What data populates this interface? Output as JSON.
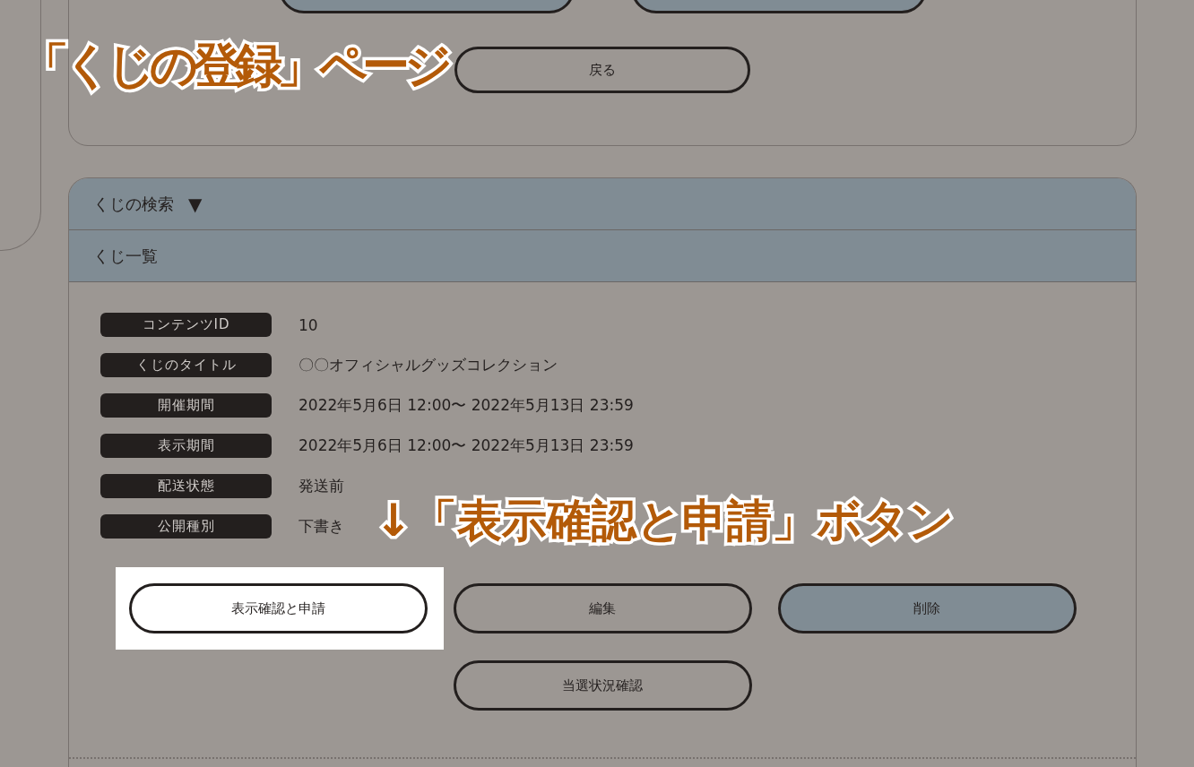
{
  "annotations": [
    {
      "text": "「くじの登録」ページ"
    },
    {
      "text": "↓「表示確認と申請」ボタン"
    }
  ],
  "top_card": {
    "button_rows": [
      [
        {
          "kind": "filled"
        },
        {
          "kind": "filled"
        }
      ],
      [
        {
          "kind": "outline",
          "label": "戻る"
        }
      ]
    ]
  },
  "lottery_card": {
    "sections": [
      {
        "title": "くじの検索",
        "toggle": "▼"
      },
      {
        "title": "くじ一覧"
      }
    ],
    "details": [
      {
        "label": "コンテンツID",
        "value": "10"
      },
      {
        "label": "くじのタイトル",
        "value": "〇〇オフィシャルグッズコレクション"
      },
      {
        "label": "開催期間",
        "value": "2022年5月6日 12:00〜 2022年5月13日 23:59"
      },
      {
        "label": "表示期間",
        "value": "2022年5月6日 12:00〜 2022年5月13日 23:59"
      },
      {
        "label": "配送状態",
        "value": "発送前"
      },
      {
        "label": "公開種別",
        "value": "下書き"
      }
    ],
    "button_rows": [
      [
        {
          "kind": "white",
          "label": "表示確認と申請",
          "highlighted": true
        },
        {
          "kind": "outline",
          "label": "編集",
          "highlighted": false
        },
        {
          "kind": "filled",
          "label": "削除",
          "highlighted": false
        }
      ],
      [
        {
          "kind": "outline",
          "label": "当選状況確認",
          "highlighted": false
        }
      ]
    ]
  }
}
